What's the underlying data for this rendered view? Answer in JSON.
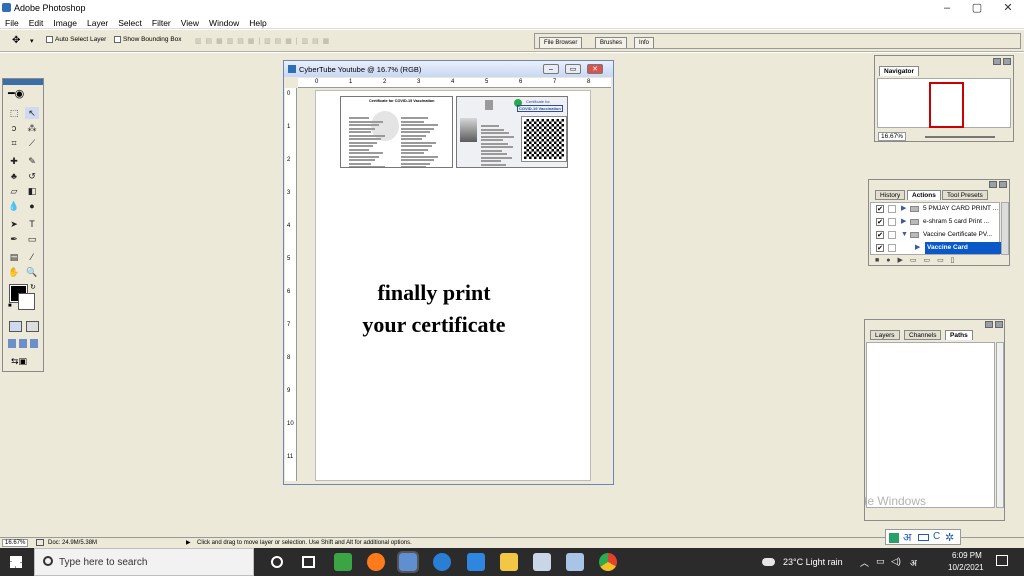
{
  "window": {
    "title": "Adobe Photoshop",
    "minimize": "–",
    "maximize": "▢",
    "close": "✕"
  },
  "menu": [
    "File",
    "Edit",
    "Image",
    "Layer",
    "Select",
    "Filter",
    "View",
    "Window",
    "Help"
  ],
  "options": {
    "auto_select": "Auto Select Layer",
    "bounding_box": "Show Bounding Box",
    "tool_arrow": "▾"
  },
  "palette_well": {
    "tabs": [
      "File Browser",
      "Brushes",
      "Info"
    ]
  },
  "document": {
    "title": "CyberTube Youtube @ 16.7% (RGB)",
    "minimize": "–",
    "restore": "▭",
    "close": "✕",
    "text_line1": "finally print",
    "text_line2": "your certificate",
    "ruler_h": [
      "0",
      "1",
      "2",
      "3",
      "4",
      "5",
      "6",
      "7",
      "8"
    ],
    "ruler_v": [
      "0",
      "1",
      "2",
      "3",
      "4",
      "5",
      "6",
      "7",
      "8",
      "9",
      "10",
      "11"
    ],
    "card1_title": "Certificate for COVID-19 Vaccination",
    "card2_title_a": "Certificate for",
    "card2_title_b": "COVID-19 Vaccination"
  },
  "navigator": {
    "tab": "Navigator",
    "zoom": "16.67%"
  },
  "actions": {
    "tabs": [
      "History",
      "Actions",
      "Tool Presets"
    ],
    "items": [
      {
        "label": "5 PMJAY CARD PRINT ...",
        "check": "✔",
        "arrow": "▶"
      },
      {
        "label": "e-shram 5 card Print ...",
        "check": "✔",
        "arrow": "▶"
      },
      {
        "label": "Vaccine Certificate PV...",
        "check": "✔",
        "arrow": "▼"
      },
      {
        "label": "Vaccine Card",
        "check": "✔",
        "arrow": "▶"
      }
    ]
  },
  "layers": {
    "tabs": [
      "Layers",
      "Channels",
      "Paths"
    ]
  },
  "watermark": "te Windows",
  "status": {
    "zoom": "16.67%",
    "doc": "Doc: 24.9M/5.38M",
    "hint": "Click and drag to move layer or selection. Use Shift and Alt for additional options.",
    "hint_arrow": "▶"
  },
  "taskbar": {
    "search_placeholder": "Type here to search",
    "weather": "23°C  Light rain",
    "time": "6:09 PM",
    "date": "10/2/2021",
    "ime": "अ",
    "lang_letter": "C"
  },
  "icons": {
    "start": "windows-logo-icon",
    "search": "search-icon",
    "cortana": "circle-icon",
    "taskview": "task-view-icon"
  }
}
